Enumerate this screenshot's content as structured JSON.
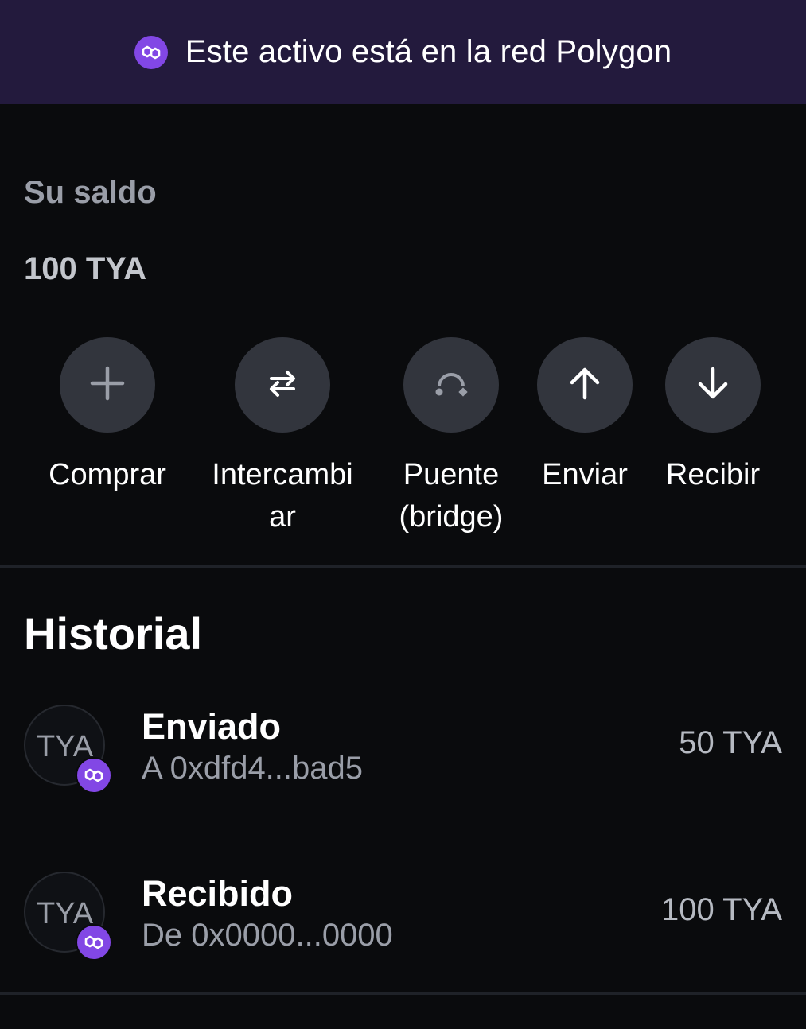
{
  "banner": {
    "icon": "polygon-icon",
    "text": "Este activo está en la red Polygon",
    "color": "#231a3d"
  },
  "balance": {
    "label": "Su saldo",
    "value": "100 TYA"
  },
  "actions": [
    {
      "label": "Comprar",
      "icon": "plus-icon"
    },
    {
      "label": "Intercambi\nar",
      "icon": "swap-icon"
    },
    {
      "label": "Puente\n(bridge)",
      "icon": "bridge-icon"
    },
    {
      "label": "Enviar",
      "icon": "arrow-up-icon"
    },
    {
      "label": "Recibir",
      "icon": "arrow-down-icon"
    }
  ],
  "history": {
    "title": "Historial",
    "items": [
      {
        "avatar": "TYA",
        "title": "Enviado",
        "subtitle": "A 0xdfd4...bad5",
        "amount": "50 TYA"
      },
      {
        "avatar": "TYA",
        "title": "Recibido",
        "subtitle": "De 0x0000...0000",
        "amount": "100 TYA"
      }
    ]
  },
  "colors": {
    "background": "#0a0b0d",
    "accent": "#8247e5",
    "action_circle": "#32353d"
  }
}
